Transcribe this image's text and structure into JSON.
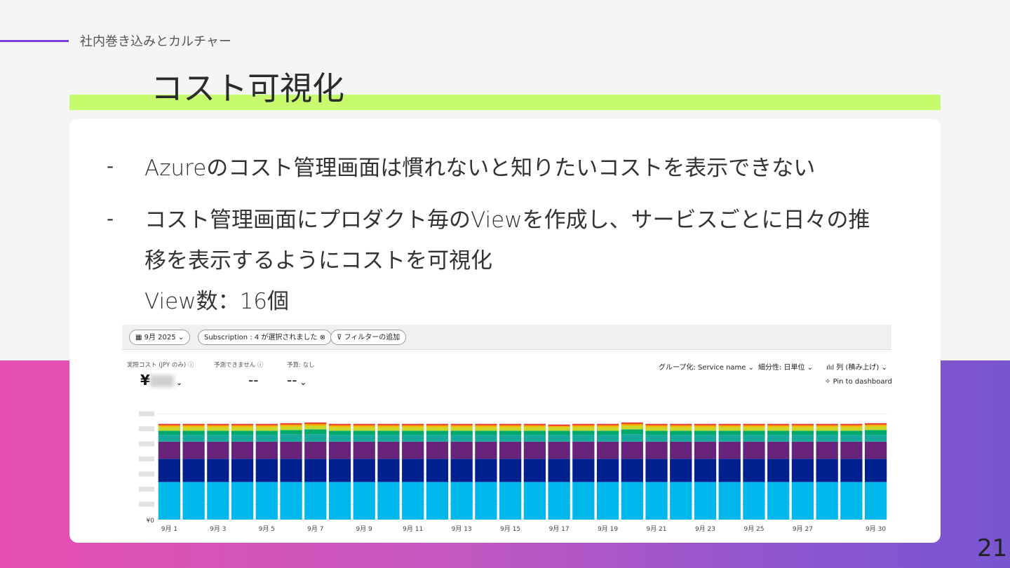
{
  "slide": {
    "section": "社内巻き込みとカルチャー",
    "title": "コスト可視化",
    "page_number": "21",
    "accent_color": "#c6fb6e",
    "line_color": "#7a3bd8"
  },
  "bullets": {
    "dash": "-",
    "b1": "Azureのコスト管理画面は慣れないと知りたいコストを表示できない",
    "b2_line1": "コスト管理画面にプロダクト毎のViewを作成し、サービスごとに日々の推",
    "b2_line2": "移を表示するようにコストを可視化",
    "b2_line3": "View数：16個"
  },
  "screenshot": {
    "toolbar": {
      "date_pill": "9月 2025",
      "subscription_pill": "Subscription : 4 が選択されました",
      "filter_pill": "フィルターの追加"
    },
    "summary": {
      "actual_cost_label": "実際コスト (JPY のみ)",
      "actual_cost_value": "¥",
      "forecast_label": "予測できません",
      "forecast_value": "--",
      "budget_label": "予算: なし",
      "budget_value": "--"
    },
    "controls": {
      "group_by": "グループ化: Service name",
      "granularity": "細分性: 日単位",
      "chart_view": "列 (積み上げ)",
      "pin": "Pin to dashboard"
    }
  },
  "chart_data": {
    "type": "bar",
    "stacked": true,
    "categories": [
      "9月 1",
      "9月 2",
      "9月 3",
      "9月 4",
      "9月 5",
      "9月 6",
      "9月 7",
      "9月 8",
      "9月 9",
      "9月 10",
      "9月 11",
      "9月 12",
      "9月 13",
      "9月 14",
      "9月 15",
      "9月 16",
      "9月 17",
      "9月 18",
      "9月 19",
      "9月 20",
      "9月 21",
      "9月 22",
      "9月 23",
      "9月 24",
      "9月 25",
      "9月 26",
      "9月 27",
      "9月 28",
      "9月 29",
      "9月 30"
    ],
    "x_tick_labels": [
      "9月 1",
      "9月 3",
      "9月 5",
      "9月 7",
      "9月 9",
      "9月 11",
      "9月 13",
      "9月 15",
      "9月 17",
      "9月 19",
      "9月 21",
      "9月 23",
      "9月 25",
      "9月 27",
      "9月 30"
    ],
    "y_zero_label": "¥0",
    "series_colors": [
      "#00b7eb",
      "#00208f",
      "#6a237a",
      "#16a89a",
      "#00a86b",
      "#c8d828",
      "#f4b400",
      "#e8312c"
    ],
    "series": [
      {
        "values": [
          55,
          55,
          55,
          55,
          55,
          55,
          55,
          55,
          55,
          55,
          55,
          55,
          55,
          55,
          55,
          55,
          55,
          55,
          55,
          55,
          55,
          55,
          55,
          55,
          55,
          55,
          55,
          55,
          55,
          55
        ]
      },
      {
        "values": [
          34,
          34,
          34,
          34,
          34,
          34,
          34,
          34,
          34,
          34,
          34,
          34,
          34,
          34,
          34,
          34,
          34,
          34,
          34,
          34,
          34,
          34,
          34,
          34,
          34,
          34,
          34,
          34,
          34,
          34
        ]
      },
      {
        "values": [
          25,
          25,
          25,
          25,
          25,
          25,
          25,
          25,
          25,
          25,
          25,
          25,
          25,
          25,
          25,
          25,
          25,
          25,
          25,
          25,
          25,
          25,
          25,
          25,
          25,
          25,
          25,
          25,
          25,
          25
        ]
      },
      {
        "values": [
          10,
          10,
          10,
          10,
          10,
          11,
          11,
          10,
          10,
          10,
          10,
          10,
          10,
          10,
          10,
          10,
          10,
          10,
          10,
          11,
          10,
          10,
          10,
          10,
          10,
          10,
          10,
          10,
          10,
          10
        ]
      },
      {
        "values": [
          6,
          6,
          6,
          6,
          6,
          6,
          7,
          6,
          6,
          6,
          6,
          6,
          6,
          6,
          6,
          6,
          6,
          6,
          6,
          7,
          6,
          6,
          6,
          6,
          6,
          6,
          6,
          6,
          6,
          7
        ]
      },
      {
        "values": [
          5,
          5,
          5,
          5,
          5,
          5,
          5,
          5,
          5,
          5,
          5,
          5,
          5,
          5,
          5,
          5,
          5,
          5,
          5,
          5,
          5,
          5,
          5,
          5,
          5,
          5,
          5,
          5,
          5,
          5
        ]
      },
      {
        "values": [
          3,
          3,
          3,
          3,
          3,
          3,
          3,
          3,
          3,
          3,
          3,
          3,
          3,
          3,
          3,
          3,
          2,
          3,
          3,
          3,
          3,
          3,
          3,
          3,
          3,
          3,
          3,
          3,
          3,
          3
        ]
      },
      {
        "values": [
          2,
          2,
          2,
          2,
          2,
          2,
          2,
          2,
          2,
          2,
          2,
          2,
          2,
          2,
          2,
          2,
          2,
          2,
          2,
          2,
          2,
          2,
          2,
          2,
          2,
          2,
          2,
          2,
          2,
          2
        ]
      }
    ],
    "ylim": [
      0,
      160
    ]
  }
}
